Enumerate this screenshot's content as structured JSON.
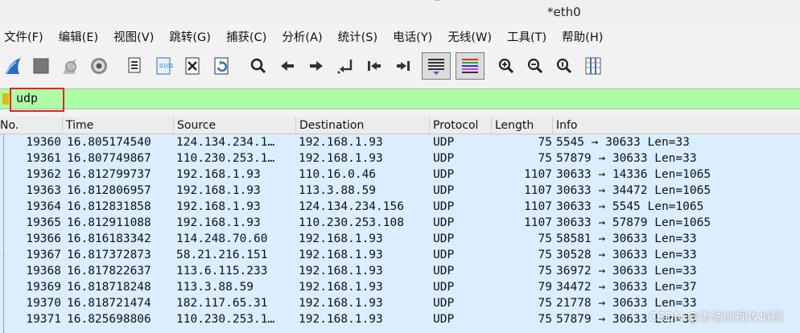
{
  "window": {
    "title": "*eth0"
  },
  "menu": [
    "文件(F)",
    "编辑(E)",
    "视图(V)",
    "跳转(G)",
    "捕获(C)",
    "分析(A)",
    "统计(S)",
    "电话(Y)",
    "无线(W)",
    "工具(T)",
    "帮助(H)"
  ],
  "toolbar": {
    "icons": [
      "shark-fin-start-icon",
      "stop-square-icon",
      "restart-capture-icon",
      "capture-options-gear-icon",
      "open-file-icon",
      "save-file-icon",
      "close-file-icon",
      "reload-file-icon",
      "find-packet-search-icon",
      "go-back-arrow-icon",
      "go-forward-arrow-icon",
      "go-to-packet-icon",
      "go-first-packet-icon",
      "go-last-packet-icon",
      "auto-scroll-icon",
      "colorize-icon",
      "zoom-in-icon",
      "zoom-out-icon",
      "zoom-normal-icon",
      "resize-columns-icon"
    ]
  },
  "filter": {
    "value": "udp"
  },
  "columns": [
    "No.",
    "Time",
    "Source",
    "Destination",
    "Protocol",
    "Length",
    "Info"
  ],
  "packets": [
    {
      "no": "19360",
      "time": "16.805174540",
      "src": "124.134.234.1…",
      "dst": "192.168.1.93",
      "proto": "UDP",
      "len": "75",
      "info": "5545 → 30633 Len=33"
    },
    {
      "no": "19361",
      "time": "16.807749867",
      "src": "110.230.253.1…",
      "dst": "192.168.1.93",
      "proto": "UDP",
      "len": "75",
      "info": "57879 → 30633 Len=33"
    },
    {
      "no": "19362",
      "time": "16.812799737",
      "src": "192.168.1.93",
      "dst": "110.16.0.46",
      "proto": "UDP",
      "len": "1107",
      "info": "30633 → 14336 Len=1065"
    },
    {
      "no": "19363",
      "time": "16.812806957",
      "src": "192.168.1.93",
      "dst": "113.3.88.59",
      "proto": "UDP",
      "len": "1107",
      "info": "30633 → 34472 Len=1065"
    },
    {
      "no": "19364",
      "time": "16.812831858",
      "src": "192.168.1.93",
      "dst": "124.134.234.156",
      "proto": "UDP",
      "len": "1107",
      "info": "30633 → 5545 Len=1065"
    },
    {
      "no": "19365",
      "time": "16.812911088",
      "src": "192.168.1.93",
      "dst": "110.230.253.108",
      "proto": "UDP",
      "len": "1107",
      "info": "30633 → 57879 Len=1065"
    },
    {
      "no": "19366",
      "time": "16.816183342",
      "src": "114.248.70.60",
      "dst": "192.168.1.93",
      "proto": "UDP",
      "len": "75",
      "info": "58581 → 30633 Len=33"
    },
    {
      "no": "19367",
      "time": "16.817372873",
      "src": "58.21.216.151",
      "dst": "192.168.1.93",
      "proto": "UDP",
      "len": "75",
      "info": "30528 → 30633 Len=33"
    },
    {
      "no": "19368",
      "time": "16.817822637",
      "src": "113.6.115.233",
      "dst": "192.168.1.93",
      "proto": "UDP",
      "len": "75",
      "info": "36972 → 30633 Len=33"
    },
    {
      "no": "19369",
      "time": "16.818718248",
      "src": "113.3.88.59",
      "dst": "192.168.1.93",
      "proto": "UDP",
      "len": "79",
      "info": "34472 → 30633 Len=37"
    },
    {
      "no": "19370",
      "time": "16.818721474",
      "src": "182.117.65.31",
      "dst": "192.168.1.93",
      "proto": "UDP",
      "len": "75",
      "info": "21778 → 30633 Len=33"
    },
    {
      "no": "19371",
      "time": "16.825698806",
      "src": "110.230.253.1…",
      "dst": "192.168.1.93",
      "proto": "UDP",
      "len": "75",
      "info": "57879 → 30633 Len=33"
    }
  ],
  "watermark": "CSDN @渗透侧视攻城狮"
}
